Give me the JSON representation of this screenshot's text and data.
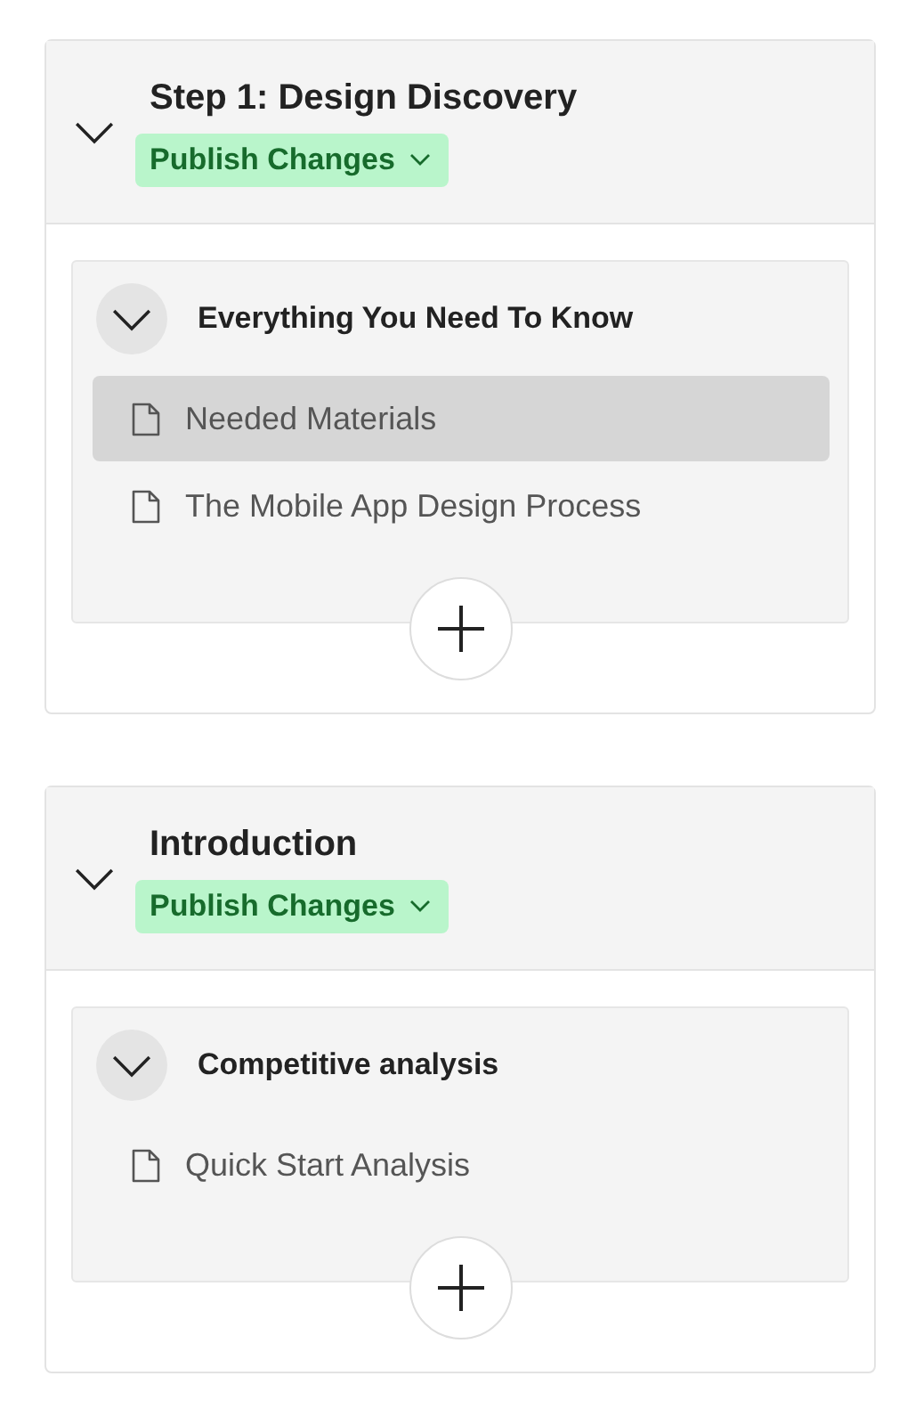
{
  "sections": [
    {
      "title": "Step 1: Design Discovery",
      "expanded": true,
      "status": "Publish Changes",
      "group": {
        "title": "Everything You Need To Know",
        "expanded": true,
        "items": [
          {
            "label": "Needed Materials",
            "selected": true
          },
          {
            "label": "The Mobile App Design Process",
            "selected": false
          }
        ]
      }
    },
    {
      "title": "Introduction",
      "expanded": true,
      "status": "Publish Changes",
      "group": {
        "title": "Competitive analysis",
        "expanded": true,
        "items": [
          {
            "label": "Quick Start Analysis",
            "selected": false
          }
        ]
      }
    }
  ]
}
